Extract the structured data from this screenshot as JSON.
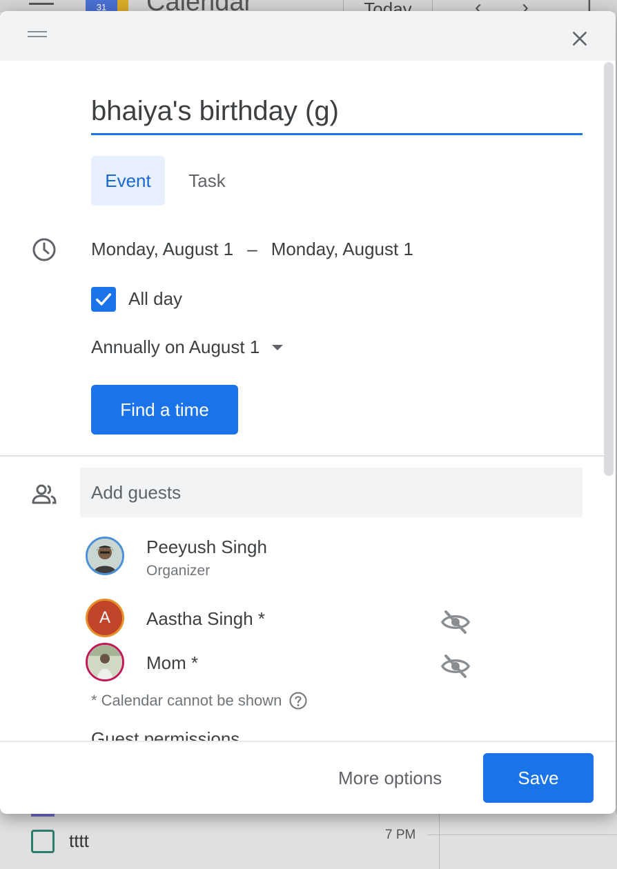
{
  "background": {
    "app_title": "Calendar",
    "today_button": "Today",
    "logo_number": "31",
    "task_item": "tttt",
    "time_label": "7 PM"
  },
  "dialog": {
    "title_value": "bhaiya's birthday (g)",
    "tabs": [
      {
        "label": "Event",
        "selected": true
      },
      {
        "label": "Task",
        "selected": false
      }
    ],
    "start_date": "Monday, August 1",
    "date_separator": "–",
    "end_date": "Monday, August 1",
    "all_day": {
      "label": "All day",
      "checked": true
    },
    "repeat": "Annually on August 1",
    "find_time_label": "Find a time",
    "guests": {
      "placeholder": "Add guests",
      "list": [
        {
          "name": "Peeyush Singh",
          "role": "Organizer"
        },
        {
          "name": "Aastha Singh *",
          "initial": "A"
        },
        {
          "name": "Mom *"
        }
      ],
      "note": "* Calendar cannot be shown"
    },
    "guest_permissions_label": "Guest permissions",
    "more_options_label": "More options",
    "save_label": "Save"
  },
  "colors": {
    "accent": "#1a73e8",
    "tab_selected_bg": "#e8f0fe",
    "aastha_avatar": "#c0442a",
    "aastha_ring": "#e8912a",
    "peeyush_ring": "#4a90d9",
    "mom_ring": "#c2185b"
  }
}
